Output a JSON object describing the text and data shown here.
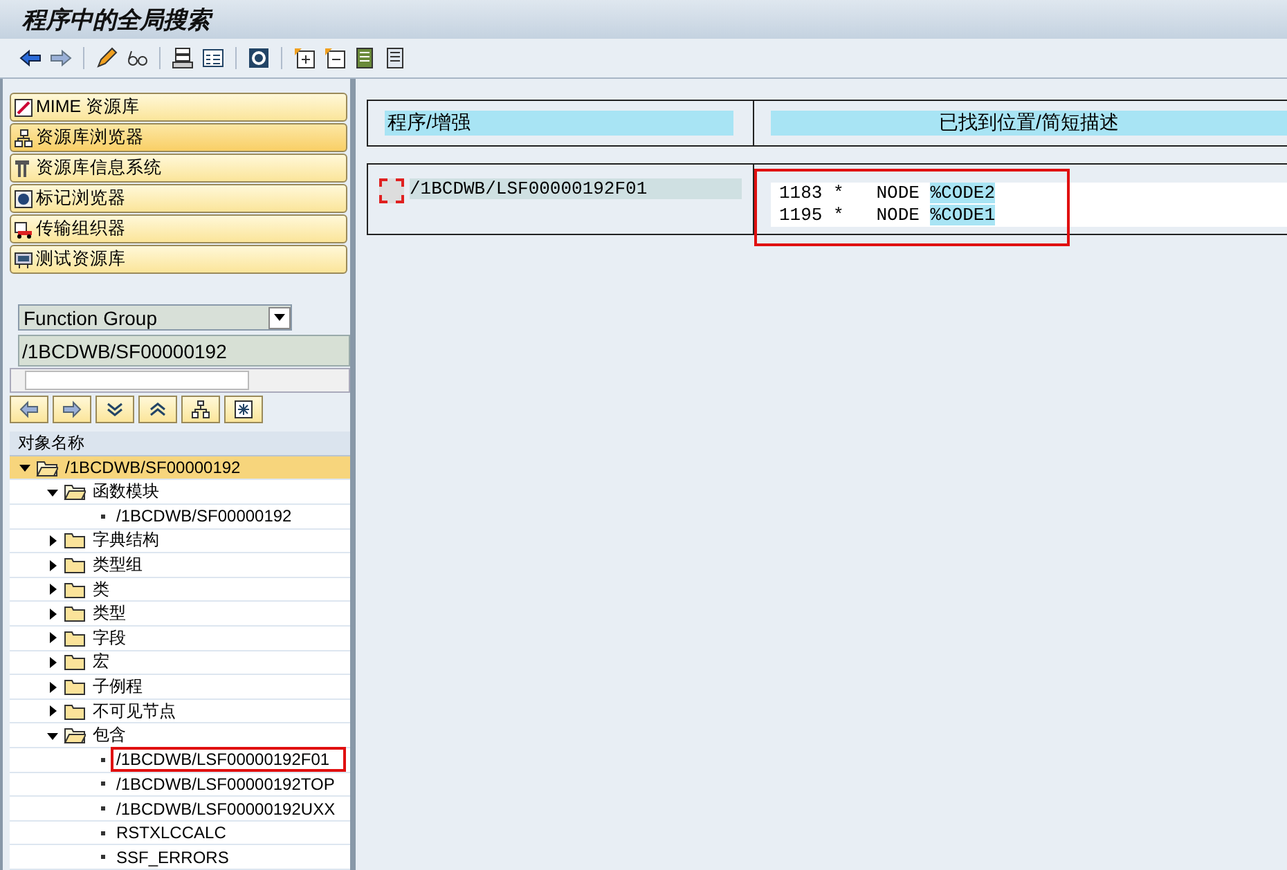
{
  "window": {
    "title": "程序中的全局搜索"
  },
  "nav_buttons": [
    {
      "label": "MIME 资源库",
      "kind": "mime",
      "selected": false
    },
    {
      "label": "资源库浏览器",
      "kind": "browser",
      "selected": true
    },
    {
      "label": "资源库信息系统",
      "kind": "info",
      "selected": false
    },
    {
      "label": "标记浏览器",
      "kind": "tag",
      "selected": false
    },
    {
      "label": "传输组织器",
      "kind": "transport",
      "selected": false
    },
    {
      "label": "测试资源库",
      "kind": "test",
      "selected": false
    }
  ],
  "object_type": {
    "value": "Function Group"
  },
  "object_name": {
    "value": "/1BCDWB/SF00000192"
  },
  "tree": {
    "header": "对象名称",
    "items": [
      {
        "label": "/1BCDWB/SF00000192",
        "kind": "folder",
        "expanded": true,
        "selected": true,
        "marked": false,
        "children": [
          {
            "label": "函数模块",
            "kind": "folder",
            "expanded": true,
            "selected": false,
            "marked": false,
            "children": [
              {
                "label": "/1BCDWB/SF00000192",
                "kind": "leaf",
                "selected": false,
                "marked": false
              }
            ]
          },
          {
            "label": "字典结构",
            "kind": "folder",
            "expanded": false,
            "selected": false,
            "marked": false
          },
          {
            "label": "类型组",
            "kind": "folder",
            "expanded": false,
            "selected": false,
            "marked": false
          },
          {
            "label": "类",
            "kind": "folder",
            "expanded": false,
            "selected": false,
            "marked": false
          },
          {
            "label": "类型",
            "kind": "folder",
            "expanded": false,
            "selected": false,
            "marked": false
          },
          {
            "label": "字段",
            "kind": "folder",
            "expanded": false,
            "selected": false,
            "marked": false
          },
          {
            "label": "宏",
            "kind": "folder",
            "expanded": false,
            "selected": false,
            "marked": false
          },
          {
            "label": "子例程",
            "kind": "folder",
            "expanded": false,
            "selected": false,
            "marked": false
          },
          {
            "label": "不可见节点",
            "kind": "folder",
            "expanded": false,
            "selected": false,
            "marked": false
          },
          {
            "label": "包含",
            "kind": "folder",
            "expanded": true,
            "selected": false,
            "marked": false,
            "children": [
              {
                "label": "/1BCDWB/LSF00000192F01",
                "kind": "leaf",
                "selected": false,
                "marked": true
              },
              {
                "label": "/1BCDWB/LSF00000192TOP",
                "kind": "leaf",
                "selected": false,
                "marked": false
              },
              {
                "label": "/1BCDWB/LSF00000192UXX",
                "kind": "leaf",
                "selected": false,
                "marked": false
              },
              {
                "label": "RSTXLCCALC",
                "kind": "leaf",
                "selected": false,
                "marked": false
              },
              {
                "label": "SSF_ERRORS",
                "kind": "leaf",
                "selected": false,
                "marked": false
              }
            ]
          }
        ]
      }
    ]
  },
  "results": {
    "columns": [
      "程序/增强",
      "已找到位置/简短描述"
    ],
    "rows": [
      {
        "program": "/1BCDWB/LSF00000192F01",
        "checked": false,
        "marked": true,
        "lines": [
          {
            "text": "1183 *   NODE ",
            "match": "%CODE2"
          },
          {
            "text": "1195 *   NODE ",
            "match": "%CODE1"
          }
        ]
      }
    ]
  }
}
